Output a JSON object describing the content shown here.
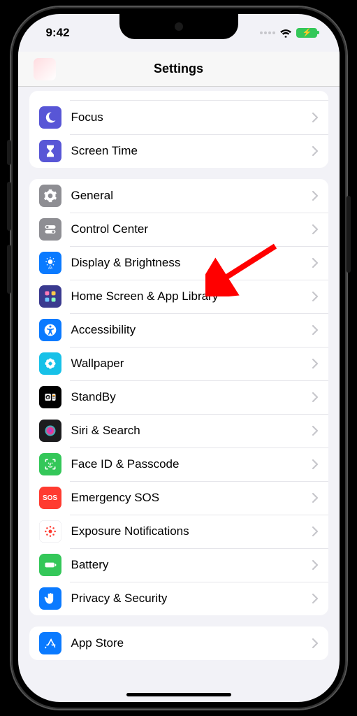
{
  "status": {
    "time": "9:42"
  },
  "header": {
    "title": "Settings"
  },
  "groups": [
    {
      "partial_top": true,
      "rows": [
        {
          "id": "focus",
          "label": "Focus",
          "icon": "moon-icon",
          "bg": "#5856d6"
        },
        {
          "id": "screen-time",
          "label": "Screen Time",
          "icon": "hourglass-icon",
          "bg": "#5856d6"
        }
      ]
    },
    {
      "rows": [
        {
          "id": "general",
          "label": "General",
          "icon": "gear-icon",
          "bg": "#8e8e93"
        },
        {
          "id": "control-center",
          "label": "Control Center",
          "icon": "switches-icon",
          "bg": "#8e8e93"
        },
        {
          "id": "display-brightness",
          "label": "Display & Brightness",
          "icon": "sun-text-icon",
          "bg": "#0a7aff"
        },
        {
          "id": "home-screen",
          "label": "Home Screen & App Library",
          "icon": "grid-icon",
          "bg": "#3a3a8f"
        },
        {
          "id": "accessibility",
          "label": "Accessibility",
          "icon": "accessibility-icon",
          "bg": "#0a7aff"
        },
        {
          "id": "wallpaper",
          "label": "Wallpaper",
          "icon": "flower-icon",
          "bg": "#17c1e8"
        },
        {
          "id": "standby",
          "label": "StandBy",
          "icon": "standby-icon",
          "bg": "#000000"
        },
        {
          "id": "siri-search",
          "label": "Siri & Search",
          "icon": "siri-icon",
          "bg": "#1c1c1e"
        },
        {
          "id": "faceid",
          "label": "Face ID & Passcode",
          "icon": "faceid-icon",
          "bg": "#34c759"
        },
        {
          "id": "emergency-sos",
          "label": "Emergency SOS",
          "icon": "sos-icon",
          "bg": "#ff3b30",
          "text_icon": "SOS"
        },
        {
          "id": "exposure",
          "label": "Exposure Notifications",
          "icon": "exposure-icon",
          "bg": "#ffffff",
          "fg": "#ff3b30",
          "border": true
        },
        {
          "id": "battery",
          "label": "Battery",
          "icon": "battery-icon",
          "bg": "#34c759"
        },
        {
          "id": "privacy",
          "label": "Privacy & Security",
          "icon": "hand-icon",
          "bg": "#0a7aff"
        }
      ]
    },
    {
      "rows": [
        {
          "id": "app-store",
          "label": "App Store",
          "icon": "appstore-icon",
          "bg": "#0a7aff"
        }
      ]
    }
  ],
  "annotation": {
    "arrow_color": "#ff0000",
    "target": "display-brightness"
  }
}
